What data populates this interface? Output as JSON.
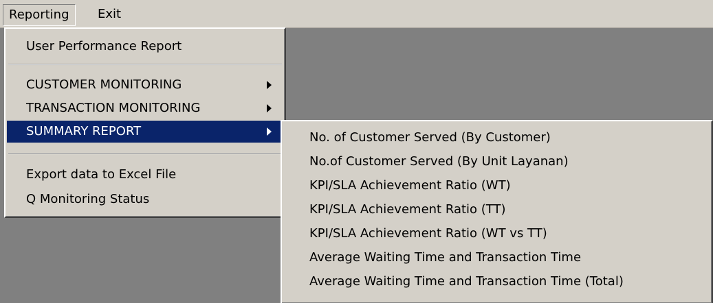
{
  "menubar": {
    "items": [
      {
        "label": "Reporting"
      },
      {
        "label": "Exit"
      }
    ]
  },
  "reporting_menu": {
    "items": [
      {
        "label": "User Performance Report"
      },
      {
        "label": "CUSTOMER MONITORING"
      },
      {
        "label": "TRANSACTION MONITORING"
      },
      {
        "label": "SUMMARY REPORT"
      },
      {
        "label": "Export data to Excel File"
      },
      {
        "label": "Q Monitoring Status"
      }
    ]
  },
  "summary_submenu": {
    "items": [
      {
        "label": "No. of Customer Served (By Customer)"
      },
      {
        "label": "No.of Customer Served (By Unit Layanan)"
      },
      {
        "label": "KPI/SLA Achievement Ratio (WT)"
      },
      {
        "label": "KPI/SLA Achievement Ratio (TT)"
      },
      {
        "label": "KPI/SLA Achievement Ratio (WT vs TT)"
      },
      {
        "label": "Average Waiting Time and Transaction Time"
      },
      {
        "label": "Average Waiting Time and Transaction Time (Total)"
      }
    ]
  },
  "colors": {
    "menu_face": "#d4d0c8",
    "highlight": "#0a246a",
    "workspace": "#808080"
  }
}
